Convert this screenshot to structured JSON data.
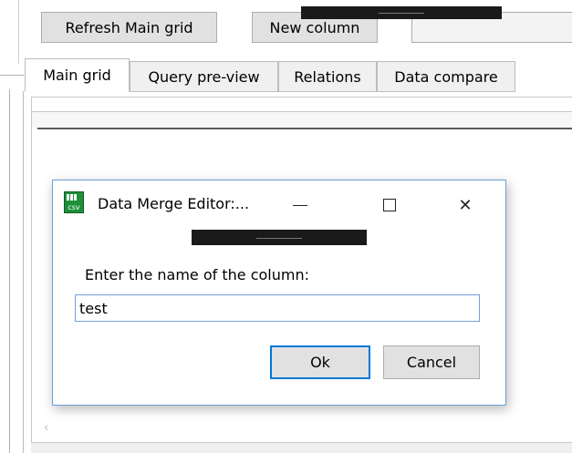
{
  "toolbar": {
    "refresh_label": "Refresh Main grid",
    "new_column_label": "New column"
  },
  "tabs": [
    {
      "label": "Main grid",
      "active": true
    },
    {
      "label": "Query pre-view",
      "active": false
    },
    {
      "label": "Relations",
      "active": false
    },
    {
      "label": "Data compare",
      "active": false
    }
  ],
  "grid": {
    "scroll_left_glyph": "‹"
  },
  "dialog": {
    "title": "Data Merge Editor:...",
    "icon": "csv-file-icon",
    "icon_text": "csv",
    "minimize_glyph": "—",
    "close_glyph": "✕",
    "prompt": "Enter the name of the column:",
    "input_value": "test",
    "ok_label": "Ok",
    "cancel_label": "Cancel"
  },
  "colors": {
    "accent_focus": "#0078d7",
    "dialog_border": "#6ca0d8",
    "button_bg": "#e1e1e1",
    "icon_green": "#1f8f3a"
  }
}
